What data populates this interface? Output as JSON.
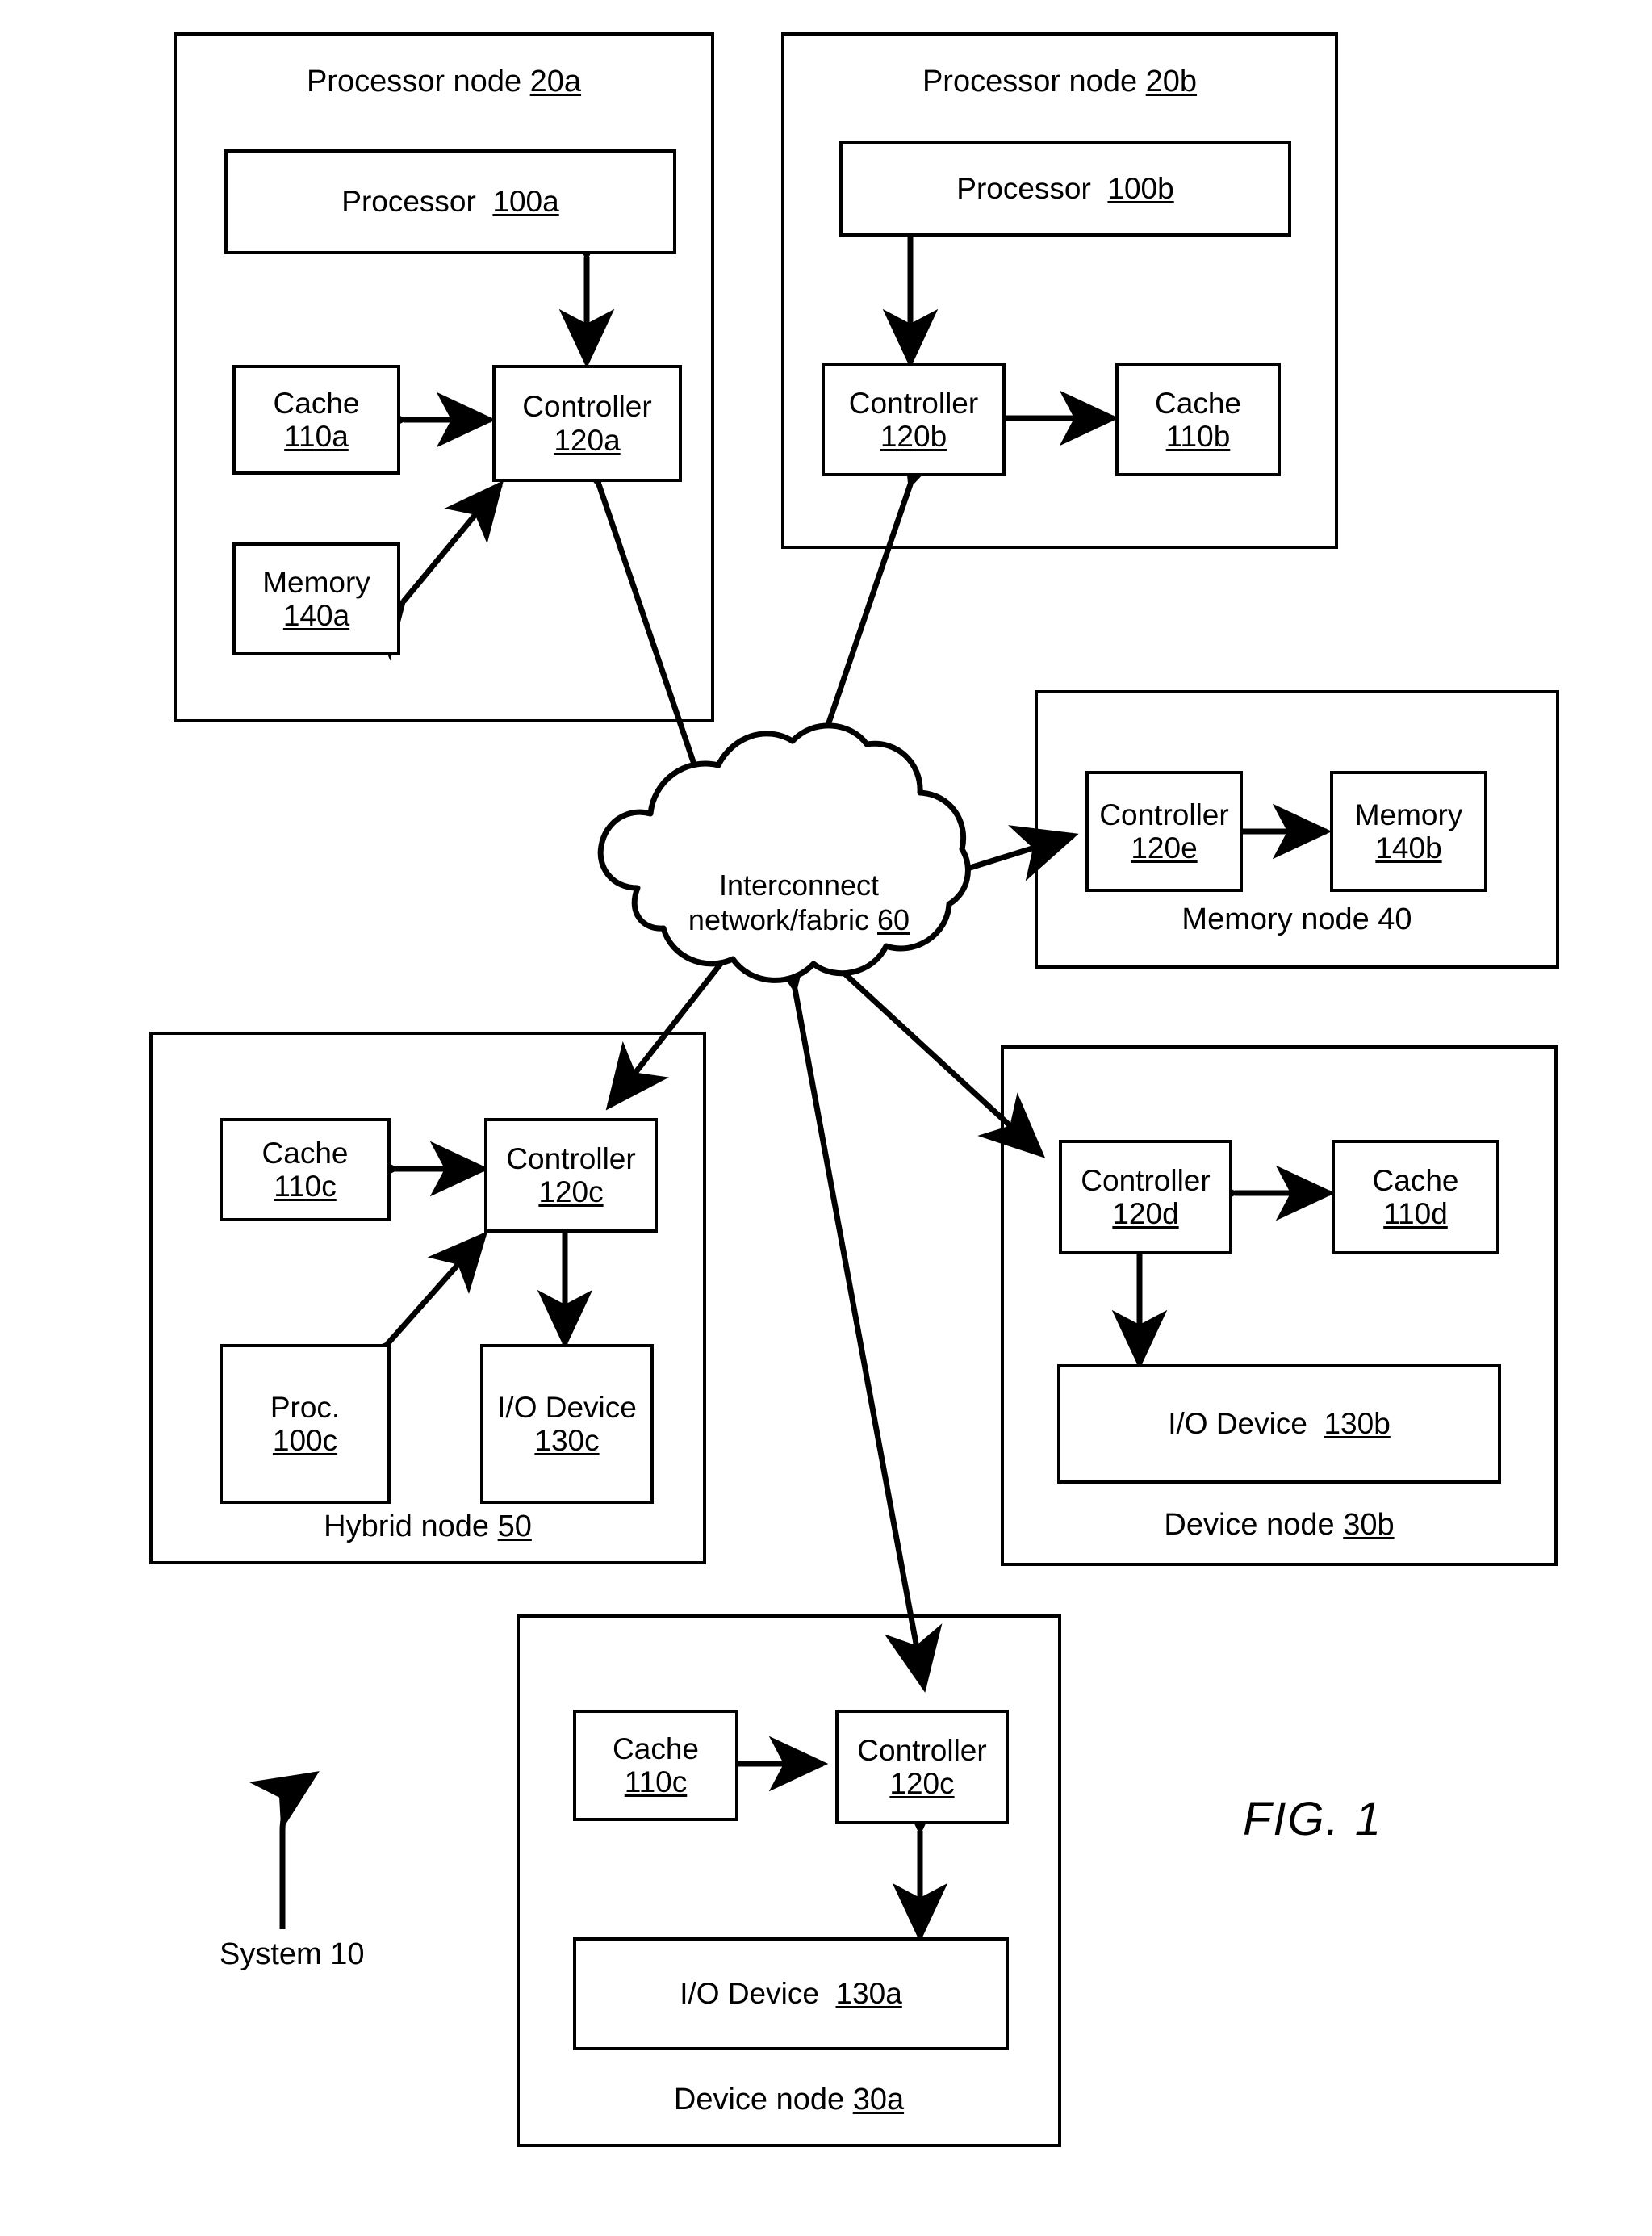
{
  "figure": {
    "label": "FIG. 1",
    "system_label": "System 10"
  },
  "cloud": {
    "line1": "Interconnect",
    "line2_text": "network/fabric ",
    "line2_ref": "60"
  },
  "nodes": [
    {
      "id": "processor-node-20a",
      "title_text": "Processor node ",
      "title_ref": "20a",
      "title_underlined": true,
      "boxes": [
        {
          "id": "processor-100a",
          "line1": "Processor  ",
          "ref": "100a",
          "inline": true
        },
        {
          "id": "cache-110a",
          "line1": "Cache",
          "ref": "110a",
          "inline": false
        },
        {
          "id": "controller-120a",
          "line1": "Controller",
          "ref": "120a",
          "inline": false
        },
        {
          "id": "memory-140a",
          "line1": "Memory",
          "ref": "140a",
          "inline": false
        }
      ]
    },
    {
      "id": "processor-node-20b",
      "title_text": "Processor node ",
      "title_ref": "20b",
      "title_underlined": true,
      "boxes": [
        {
          "id": "processor-100b",
          "line1": "Processor  ",
          "ref": "100b",
          "inline": true
        },
        {
          "id": "controller-120b",
          "line1": "Controller",
          "ref": "120b",
          "inline": false
        },
        {
          "id": "cache-110b",
          "line1": "Cache",
          "ref": "110b",
          "inline": false
        }
      ]
    },
    {
      "id": "memory-node-40",
      "title_text": "Memory node 40",
      "title_ref": "",
      "title_underlined": false,
      "boxes": [
        {
          "id": "controller-120e",
          "line1": "Controller",
          "ref": "120e",
          "inline": false
        },
        {
          "id": "memory-140b",
          "line1": "Memory",
          "ref": "140b",
          "inline": false
        }
      ]
    },
    {
      "id": "hybrid-node-50",
      "title_text": "Hybrid node ",
      "title_ref": "50",
      "title_underlined": true,
      "boxes": [
        {
          "id": "cache-110c-hybrid",
          "line1": "Cache",
          "ref": "110c",
          "inline": false
        },
        {
          "id": "controller-120c-hybrid",
          "line1": "Controller",
          "ref": "120c",
          "inline": false
        },
        {
          "id": "proc-100c",
          "line1": "Proc.",
          "ref": "100c",
          "inline": false
        },
        {
          "id": "io-device-130c",
          "line1": "I/O Device",
          "ref": "130c",
          "inline": false
        }
      ]
    },
    {
      "id": "device-node-30b",
      "title_text": "Device node ",
      "title_ref": "30b",
      "title_underlined": true,
      "boxes": [
        {
          "id": "controller-120d",
          "line1": "Controller",
          "ref": "120d",
          "inline": false
        },
        {
          "id": "cache-110d",
          "line1": "Cache",
          "ref": "110d",
          "inline": false
        },
        {
          "id": "io-device-130b",
          "line1": "I/O Device  ",
          "ref": "130b",
          "inline": true
        }
      ]
    },
    {
      "id": "device-node-30a",
      "title_text": "Device node ",
      "title_ref": "30a",
      "title_underlined": true,
      "boxes": [
        {
          "id": "cache-110c-device",
          "line1": "Cache",
          "ref": "110c",
          "inline": false
        },
        {
          "id": "controller-120c-device",
          "line1": "Controller",
          "ref": "120c",
          "inline": false
        },
        {
          "id": "io-device-130a",
          "line1": "I/O Device  ",
          "ref": "130a",
          "inline": true
        }
      ]
    }
  ],
  "labels": {
    "n20a_title_text": "Processor node ",
    "n20a_title_ref": "20a",
    "n20b_title_text": "Processor node ",
    "n20b_title_ref": "20b",
    "n40_title": "Memory node 40",
    "n50_title_text": "Hybrid node ",
    "n50_title_ref": "50",
    "n30b_title_text": "Device node ",
    "n30b_title_ref": "30b",
    "n30a_title_text": "Device node ",
    "n30a_title_ref": "30a",
    "proc100a_name": "Processor",
    "proc100a_ref": "100a",
    "proc100b_name": "Processor",
    "proc100b_ref": "100b",
    "cache110a_name": "Cache",
    "cache110a_ref": "110a",
    "cache110b_name": "Cache",
    "cache110b_ref": "110b",
    "cache110c_h_name": "Cache",
    "cache110c_h_ref": "110c",
    "cache110c_d_name": "Cache",
    "cache110c_d_ref": "110c",
    "cache110d_name": "Cache",
    "cache110d_ref": "110d",
    "ctrl120a_name": "Controller",
    "ctrl120a_ref": "120a",
    "ctrl120b_name": "Controller",
    "ctrl120b_ref": "120b",
    "ctrl120c_h_name": "Controller",
    "ctrl120c_h_ref": "120c",
    "ctrl120c_d_name": "Controller",
    "ctrl120c_d_ref": "120c",
    "ctrl120d_name": "Controller",
    "ctrl120d_ref": "120d",
    "ctrl120e_name": "Controller",
    "ctrl120e_ref": "120e",
    "mem140a_name": "Memory",
    "mem140a_ref": "140a",
    "mem140b_name": "Memory",
    "mem140b_ref": "140b",
    "proc100c_name": "Proc.",
    "proc100c_ref": "100c",
    "io130a_name": "I/O Device",
    "io130a_ref": "130a",
    "io130b_name": "I/O Device",
    "io130b_ref": "130b",
    "io130c_name": "I/O Device",
    "io130c_ref": "130c"
  },
  "colors": {
    "ink": "#000000",
    "paper": "#ffffff"
  }
}
